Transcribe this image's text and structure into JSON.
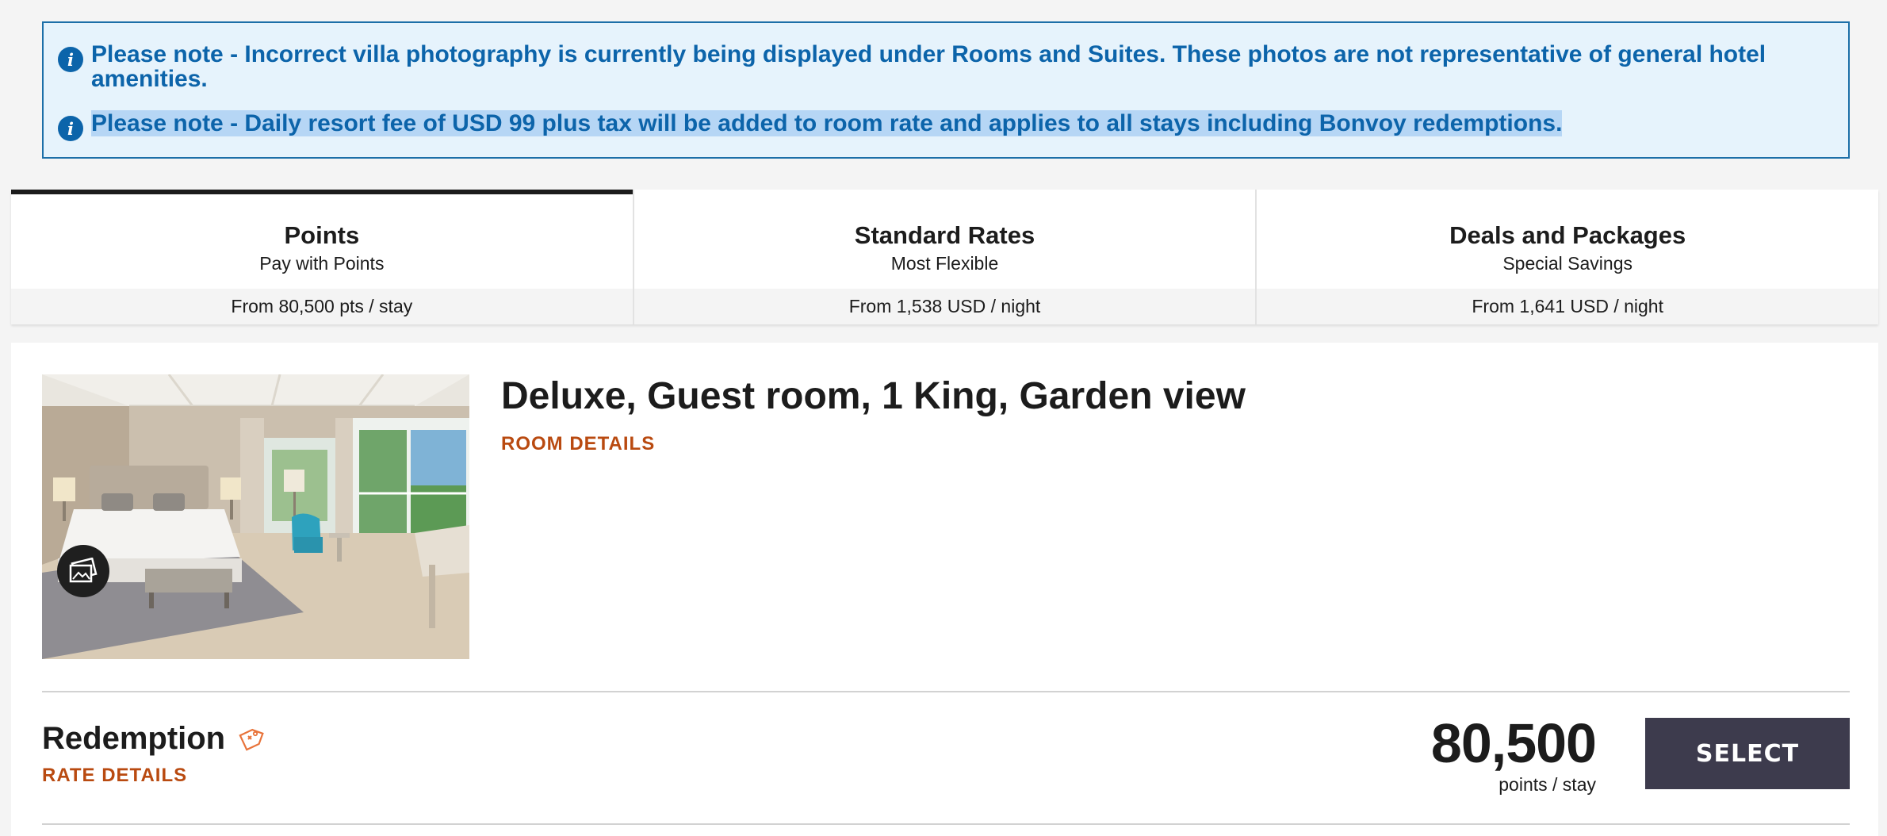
{
  "notices": [
    {
      "icon": "info-icon",
      "text": "Please note - Incorrect villa photography is currently being displayed under Rooms and Suites. These photos are not representative of general hotel amenities."
    },
    {
      "icon": "info-icon",
      "text": "Please note - Daily resort fee of USD 99 plus tax will be added to room rate and applies to all stays including Bonvoy redemptions.",
      "highlighted": true
    }
  ],
  "tabs": [
    {
      "title": "Points",
      "subtitle": "Pay with Points",
      "price": "From 80,500 pts / stay",
      "active": true
    },
    {
      "title": "Standard Rates",
      "subtitle": "Most Flexible",
      "price": "From 1,538 USD / night",
      "active": false
    },
    {
      "title": "Deals and Packages",
      "subtitle": "Special Savings",
      "price": "From 1,641 USD / night",
      "active": false
    }
  ],
  "room": {
    "title": "Deluxe, Guest room, 1 King, Garden view",
    "details_link": "ROOM DETAILS",
    "photo_icon": "gallery-icon",
    "rate": {
      "name": "Redemption",
      "tag_icon": "price-tag-icon",
      "details_link": "RATE DETAILS",
      "points": "80,500",
      "unit": "points / stay",
      "select_label": "SELECT"
    }
  },
  "colors": {
    "notice_text": "#0c64aa",
    "notice_bg": "#e6f3fc",
    "accent_link": "#b94a10",
    "select_button": "#3d3b4d"
  }
}
